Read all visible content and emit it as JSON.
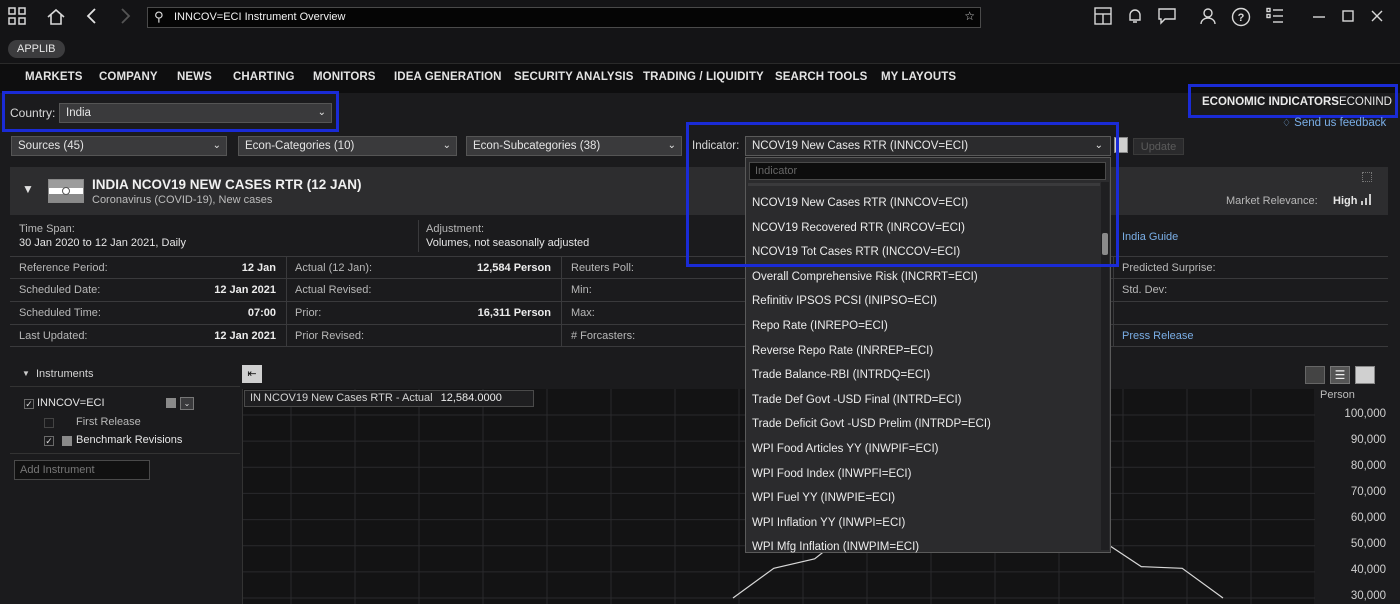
{
  "titlebar": {
    "command_text": "INNCOV=ECI Instrument Overview"
  },
  "applib": {
    "label": "APPLIB"
  },
  "nav": [
    "MARKETS",
    "COMPANY",
    "NEWS",
    "CHARTING",
    "MONITORS",
    "IDEA GENERATION",
    "SECURITY ANALYSIS",
    "TRADING / LIQUIDITY",
    "SEARCH TOOLS",
    "MY LAYOUTS"
  ],
  "country": {
    "label": "Country:",
    "value": "India"
  },
  "app_code": {
    "name": "ECONOMIC INDICATORS",
    "code": "ECONIND"
  },
  "feedback": "Send us feedback",
  "filters": {
    "sources": "Sources (45)",
    "categories": "Econ-Categories (10)",
    "subcategories": "Econ-Subcategories (38)",
    "indicator_label": "Indicator:",
    "indicator_value": "NCOV19 New Cases RTR (INNCOV=ECI)",
    "update": "Update"
  },
  "header": {
    "title": "INDIA NCOV19 NEW CASES RTR (12 JAN)",
    "subtitle": "Coronavirus (COVID-19), New cases",
    "market_relevance_label": "Market Relevance:",
    "market_relevance_value": "High"
  },
  "info": {
    "time_span_label": "Time Span:",
    "time_span_value": "30 Jan 2020 to 12 Jan 2021, Daily",
    "adjustment_label": "Adjustment:",
    "adjustment_value": "Volumes, not seasonally adjusted",
    "guide_link": "India Guide"
  },
  "grid": {
    "col1": [
      {
        "label": "Reference Period:",
        "value": "12 Jan"
      },
      {
        "label": "Scheduled Date:",
        "value": "12 Jan 2021"
      },
      {
        "label": "Scheduled Time:",
        "value": "07:00"
      },
      {
        "label": "Last Updated:",
        "value": "12 Jan 2021"
      }
    ],
    "col2": [
      {
        "label": "Actual (12 Jan):",
        "value": "12,584 Person"
      },
      {
        "label": "Actual Revised:",
        "value": ""
      },
      {
        "label": "Prior:",
        "value": "16,311 Person"
      },
      {
        "label": "Prior Revised:",
        "value": ""
      }
    ],
    "col3": [
      {
        "label": "Reuters Poll:"
      },
      {
        "label": "Min:"
      },
      {
        "label": "Max:"
      },
      {
        "label": "# Forcasters:"
      }
    ],
    "col5": [
      {
        "label": "Predicted Surprise:"
      },
      {
        "label": "Std. Dev:"
      },
      {
        "label": ""
      },
      {
        "label": "Press Release"
      }
    ]
  },
  "instruments": {
    "heading": "Instruments",
    "ric": "INNCOV=ECI",
    "first_release": "First Release",
    "benchmark": "Benchmark Revisions",
    "add_placeholder": "Add Instrument"
  },
  "chart": {
    "tooltip_series": "IN NCOV19 New Cases RTR - Actual",
    "tooltip_value": "12,584.0000",
    "unit": "Person",
    "yticks": [
      "100,000",
      "90,000",
      "80,000",
      "70,000",
      "60,000",
      "50,000",
      "40,000",
      "30,000"
    ]
  },
  "chart_data": {
    "type": "line",
    "ylabel": "Person",
    "ylim": [
      30000,
      100000
    ],
    "series": [
      {
        "name": "IN NCOV19 New Cases RTR - Actual",
        "values": [
          30000,
          36000,
          45000,
          52000,
          58000,
          62000,
          60000,
          57000,
          52000,
          47000,
          42000,
          36000,
          30000
        ]
      }
    ]
  },
  "indicator_dropdown": {
    "search_placeholder": "Indicator",
    "items": [
      "NCOV19 New Cases RTR (INNCOV=ECI)",
      "NCOV19 Recovered RTR (INRCOV=ECI)",
      "NCOV19 Tot Cases RTR (INCCOV=ECI)",
      "Overall Comprehensive Risk (INCRRT=ECI)",
      "Refinitiv IPSOS PCSI (INIPSO=ECI)",
      "Repo Rate (INREPO=ECI)",
      "Reverse Repo Rate (INRREP=ECI)",
      "Trade Balance-RBI (INTRDQ=ECI)",
      "Trade Def Govt -USD Final (INTRD=ECI)",
      "Trade Deficit Govt -USD Prelim (INTRDP=ECI)",
      "WPI Food Articles YY (INWPIF=ECI)",
      "WPI Food Index (INWPFI=ECI)",
      "WPI Fuel YY (INWPIE=ECI)",
      "WPI Inflation YY (INWPI=ECI)",
      "WPI Mfg Inflation (INWPIM=ECI)"
    ]
  },
  "colors": {
    "highlight": "#1a2bd6",
    "link": "#7aaee6"
  }
}
